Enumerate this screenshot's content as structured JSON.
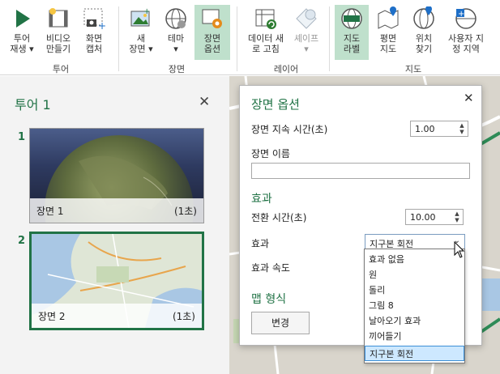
{
  "ribbon": {
    "buttons": [
      {
        "label": "투어\n재생 ▾",
        "icon": "play-icon"
      },
      {
        "label": "비디오\n만들기",
        "icon": "film-icon"
      },
      {
        "label": "화면\n캡처",
        "icon": "camera-icon"
      },
      {
        "label": "새\n장면 ▾",
        "icon": "picture-add-icon"
      },
      {
        "label": "테마\n▾",
        "icon": "globe-icon"
      },
      {
        "label": "장면\n옵션",
        "icon": "scene-options-icon",
        "active": true
      },
      {
        "label": "데이터 새\n로 고침",
        "icon": "table-refresh-icon"
      },
      {
        "label": "셰이프\n▾",
        "icon": "shapes-icon",
        "disabled": true
      },
      {
        "label": "지도\n라벨",
        "icon": "map-labels-icon",
        "active": true
      },
      {
        "label": "평면\n지도",
        "icon": "flat-map-icon"
      },
      {
        "label": "위치\n찾기",
        "icon": "find-location-icon"
      },
      {
        "label": "사용자 지\n정 지역",
        "icon": "custom-region-icon"
      }
    ],
    "groups": [
      "투어",
      "장면",
      "레이어",
      "지도"
    ]
  },
  "tour_panel": {
    "title": "투어 1",
    "close": "✕",
    "scenes": [
      {
        "number": "1",
        "name": "장면 1",
        "duration": "(1초)"
      },
      {
        "number": "2",
        "name": "장면 2",
        "duration": "(1초)"
      }
    ]
  },
  "dialog": {
    "title": "장면 옵션",
    "close": "✕",
    "duration_label": "장면 지속 시간(초)",
    "duration_value": "1.00",
    "name_label": "장면 이름",
    "name_value": "",
    "effect_section": "효과",
    "transition_label": "전환 시간(초)",
    "transition_value": "10.00",
    "effect_label": "효과",
    "effect_value": "지구본 회전",
    "speed_label": "효과 속도",
    "map_section": "맵 형식",
    "change_button": "변경"
  },
  "effect_options": [
    "효과 없음",
    "원",
    "돌리",
    "그림 8",
    "날아오기 효과",
    "끼어들기",
    "지구본 회전"
  ],
  "colors": {
    "accent": "#217346",
    "active_bg": "#bfe0cc",
    "selection": "#cde8ff"
  }
}
